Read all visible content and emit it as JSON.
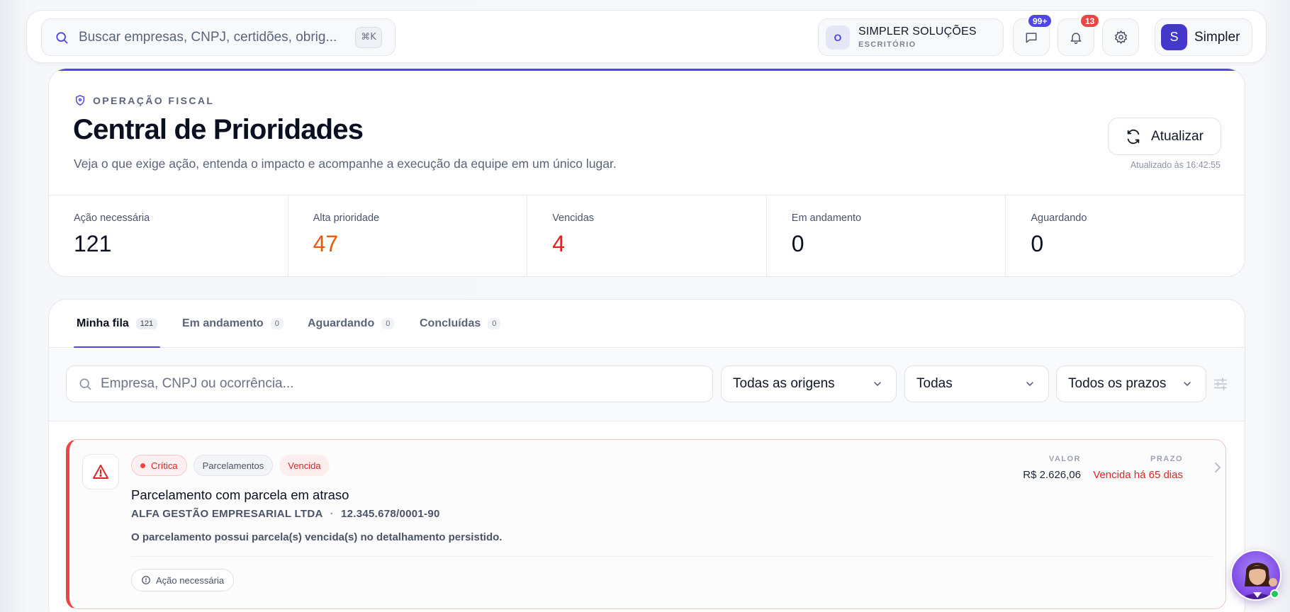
{
  "topbar": {
    "search_placeholder": "Buscar empresas, CNPJ, certidões, obrig...",
    "search_shortcut": "⌘K",
    "org": {
      "avatar_letter": "O",
      "name": "SIMPLER SOLUÇÕES",
      "type": "ESCRITÓRIO"
    },
    "messages_badge": "99+",
    "notifications_badge": "13",
    "user": {
      "avatar_letter": "S",
      "name": "Simpler"
    },
    "colors": {
      "accent": "#4f46e5",
      "badge_red": "#ef4444"
    }
  },
  "header": {
    "eyebrow": "OPERAÇÃO FISCAL",
    "title": "Central de Prioridades",
    "subtitle": "Veja o que exige ação, entenda o impacto e acompanhe a execução da equipe em um único lugar.",
    "refresh_label": "Atualizar",
    "updated_at": "Atualizado às 16:42:55"
  },
  "stats": [
    {
      "label": "Ação necessária",
      "value": "121",
      "color": "#0b1020"
    },
    {
      "label": "Alta prioridade",
      "value": "47",
      "color": "#ea580c"
    },
    {
      "label": "Vencidas",
      "value": "4",
      "color": "#dc2626"
    },
    {
      "label": "Em andamento",
      "value": "0",
      "color": "#0b1020"
    },
    {
      "label": "Aguardando",
      "value": "0",
      "color": "#0b1020"
    }
  ],
  "tabs": [
    {
      "label": "Minha fila",
      "count": "121"
    },
    {
      "label": "Em andamento",
      "count": "0"
    },
    {
      "label": "Aguardando",
      "count": "0"
    },
    {
      "label": "Concluídas",
      "count": "0"
    }
  ],
  "filters": {
    "search_placeholder": "Empresa, CNPJ ou ocorrência...",
    "origin": "Todas as origens",
    "priority": "Todas",
    "deadline": "Todos os prazos"
  },
  "items": [
    {
      "severity": "Crítica",
      "origin": "Parcelamentos",
      "status": "Vencida",
      "title": "Parcelamento com parcela em atraso",
      "company": "ALFA GESTÃO EMPRESARIAL LTDA",
      "cnpj": "12.345.678/0001-90",
      "description": "O parcelamento possui parcela(s) vencida(s) no detalhamento persistido.",
      "action": "Ação necessária",
      "value_label": "VALOR",
      "value": "R$ 2.626,06",
      "deadline_label": "PRAZO",
      "deadline": "Vencida há 65 dias"
    }
  ]
}
